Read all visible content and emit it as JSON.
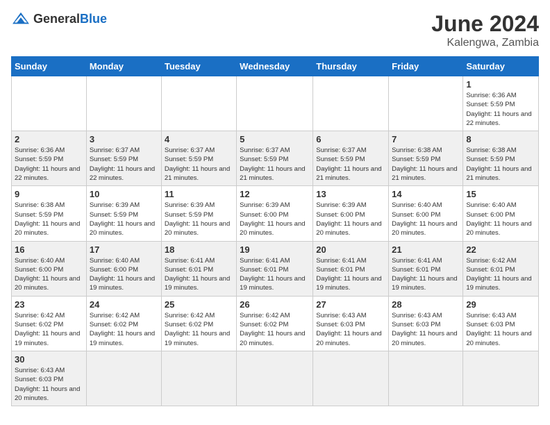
{
  "header": {
    "logo_general": "General",
    "logo_blue": "Blue",
    "month_year": "June 2024",
    "location": "Kalengwa, Zambia"
  },
  "days_of_week": [
    "Sunday",
    "Monday",
    "Tuesday",
    "Wednesday",
    "Thursday",
    "Friday",
    "Saturday"
  ],
  "weeks": [
    [
      {
        "day": "",
        "info": ""
      },
      {
        "day": "",
        "info": ""
      },
      {
        "day": "",
        "info": ""
      },
      {
        "day": "",
        "info": ""
      },
      {
        "day": "",
        "info": ""
      },
      {
        "day": "",
        "info": ""
      },
      {
        "day": "1",
        "info": "Sunrise: 6:36 AM\nSunset: 5:59 PM\nDaylight: 11 hours and 22 minutes."
      }
    ],
    [
      {
        "day": "2",
        "info": "Sunrise: 6:36 AM\nSunset: 5:59 PM\nDaylight: 11 hours and 22 minutes."
      },
      {
        "day": "3",
        "info": "Sunrise: 6:37 AM\nSunset: 5:59 PM\nDaylight: 11 hours and 22 minutes."
      },
      {
        "day": "4",
        "info": "Sunrise: 6:37 AM\nSunset: 5:59 PM\nDaylight: 11 hours and 21 minutes."
      },
      {
        "day": "5",
        "info": "Sunrise: 6:37 AM\nSunset: 5:59 PM\nDaylight: 11 hours and 21 minutes."
      },
      {
        "day": "6",
        "info": "Sunrise: 6:37 AM\nSunset: 5:59 PM\nDaylight: 11 hours and 21 minutes."
      },
      {
        "day": "7",
        "info": "Sunrise: 6:38 AM\nSunset: 5:59 PM\nDaylight: 11 hours and 21 minutes."
      },
      {
        "day": "8",
        "info": "Sunrise: 6:38 AM\nSunset: 5:59 PM\nDaylight: 11 hours and 21 minutes."
      }
    ],
    [
      {
        "day": "9",
        "info": "Sunrise: 6:38 AM\nSunset: 5:59 PM\nDaylight: 11 hours and 20 minutes."
      },
      {
        "day": "10",
        "info": "Sunrise: 6:39 AM\nSunset: 5:59 PM\nDaylight: 11 hours and 20 minutes."
      },
      {
        "day": "11",
        "info": "Sunrise: 6:39 AM\nSunset: 5:59 PM\nDaylight: 11 hours and 20 minutes."
      },
      {
        "day": "12",
        "info": "Sunrise: 6:39 AM\nSunset: 6:00 PM\nDaylight: 11 hours and 20 minutes."
      },
      {
        "day": "13",
        "info": "Sunrise: 6:39 AM\nSunset: 6:00 PM\nDaylight: 11 hours and 20 minutes."
      },
      {
        "day": "14",
        "info": "Sunrise: 6:40 AM\nSunset: 6:00 PM\nDaylight: 11 hours and 20 minutes."
      },
      {
        "day": "15",
        "info": "Sunrise: 6:40 AM\nSunset: 6:00 PM\nDaylight: 11 hours and 20 minutes."
      }
    ],
    [
      {
        "day": "16",
        "info": "Sunrise: 6:40 AM\nSunset: 6:00 PM\nDaylight: 11 hours and 20 minutes."
      },
      {
        "day": "17",
        "info": "Sunrise: 6:40 AM\nSunset: 6:00 PM\nDaylight: 11 hours and 19 minutes."
      },
      {
        "day": "18",
        "info": "Sunrise: 6:41 AM\nSunset: 6:01 PM\nDaylight: 11 hours and 19 minutes."
      },
      {
        "day": "19",
        "info": "Sunrise: 6:41 AM\nSunset: 6:01 PM\nDaylight: 11 hours and 19 minutes."
      },
      {
        "day": "20",
        "info": "Sunrise: 6:41 AM\nSunset: 6:01 PM\nDaylight: 11 hours and 19 minutes."
      },
      {
        "day": "21",
        "info": "Sunrise: 6:41 AM\nSunset: 6:01 PM\nDaylight: 11 hours and 19 minutes."
      },
      {
        "day": "22",
        "info": "Sunrise: 6:42 AM\nSunset: 6:01 PM\nDaylight: 11 hours and 19 minutes."
      }
    ],
    [
      {
        "day": "23",
        "info": "Sunrise: 6:42 AM\nSunset: 6:02 PM\nDaylight: 11 hours and 19 minutes."
      },
      {
        "day": "24",
        "info": "Sunrise: 6:42 AM\nSunset: 6:02 PM\nDaylight: 11 hours and 19 minutes."
      },
      {
        "day": "25",
        "info": "Sunrise: 6:42 AM\nSunset: 6:02 PM\nDaylight: 11 hours and 19 minutes."
      },
      {
        "day": "26",
        "info": "Sunrise: 6:42 AM\nSunset: 6:02 PM\nDaylight: 11 hours and 20 minutes."
      },
      {
        "day": "27",
        "info": "Sunrise: 6:43 AM\nSunset: 6:03 PM\nDaylight: 11 hours and 20 minutes."
      },
      {
        "day": "28",
        "info": "Sunrise: 6:43 AM\nSunset: 6:03 PM\nDaylight: 11 hours and 20 minutes."
      },
      {
        "day": "29",
        "info": "Sunrise: 6:43 AM\nSunset: 6:03 PM\nDaylight: 11 hours and 20 minutes."
      }
    ],
    [
      {
        "day": "30",
        "info": "Sunrise: 6:43 AM\nSunset: 6:03 PM\nDaylight: 11 hours and 20 minutes."
      },
      {
        "day": "",
        "info": ""
      },
      {
        "day": "",
        "info": ""
      },
      {
        "day": "",
        "info": ""
      },
      {
        "day": "",
        "info": ""
      },
      {
        "day": "",
        "info": ""
      },
      {
        "day": "",
        "info": ""
      }
    ]
  ]
}
